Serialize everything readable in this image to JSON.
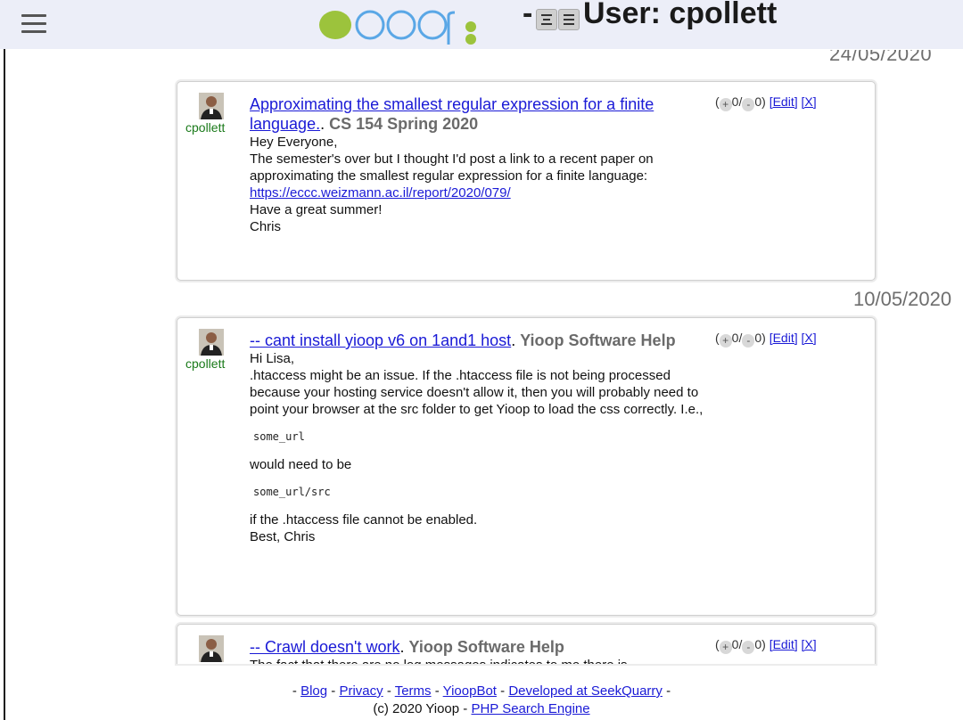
{
  "header": {
    "dash": "-",
    "title": "User: cpollett",
    "brand_color": "#9cc33c",
    "logo_blue": "#5aa7e6"
  },
  "dates": [
    "24/05/2020",
    "10/05/2020"
  ],
  "posts": [
    {
      "user": "cpollett",
      "title": "Approximating the smallest regular expression for a finite language.",
      "sep": ".",
      "group": "CS 154 Spring 2020",
      "lines": [
        "Hey Everyone,",
        "The semester's over but I thought I'd post a link to a recent paper on approximating the smallest regular expression for a finite language:"
      ],
      "url": "https://eccc.weizmann.ac.il/report/2020/079/",
      "after": [
        "Have a great summer!",
        "Chris"
      ],
      "votes": {
        "open": "(",
        "plus": "+",
        "up": "0/",
        "minus": "-",
        "down": "0)",
        "edit": "[Edit]",
        "delete": "[X]"
      }
    },
    {
      "user": "cpollett",
      "title": "-- cant install yioop v6 on 1and1 host",
      "sep": ".",
      "group": "Yioop Software Help",
      "lines": [
        "Hi Lisa,",
        ".htaccess might be an issue. If the .htaccess file is not being processed because your hosting service doesn't allow it, then you will probably need to point your browser at the src folder to get Yioop to load the css correctly. I.e.,"
      ],
      "code1": "some_url",
      "middle": "would need to be",
      "code2": "some_url/src",
      "after": [
        "if the .htaccess file cannot be enabled.",
        "Best, Chris"
      ],
      "votes": {
        "open": "(",
        "plus": "+",
        "up": "0/",
        "minus": "-",
        "down": "0)",
        "edit": "[Edit]",
        "delete": "[X]"
      }
    },
    {
      "user": "cpollett",
      "title": "-- Crawl doesn't work",
      "sep": ".",
      "group": "Yioop Software Help",
      "lines": [
        "The fact that there are no log messages indicates to me there is"
      ],
      "votes": {
        "open": "(",
        "plus": "+",
        "up": "0/",
        "minus": "-",
        "down": "0)",
        "edit": "[Edit]",
        "delete": "[X]"
      }
    }
  ],
  "footer": {
    "sep": "-",
    "links": [
      "Blog",
      "Privacy",
      "Terms",
      "YioopBot",
      "Developed at SeekQuarry"
    ],
    "copyright": "(c) 2020 Yioop",
    "engine_link": "PHP Search Engine"
  }
}
